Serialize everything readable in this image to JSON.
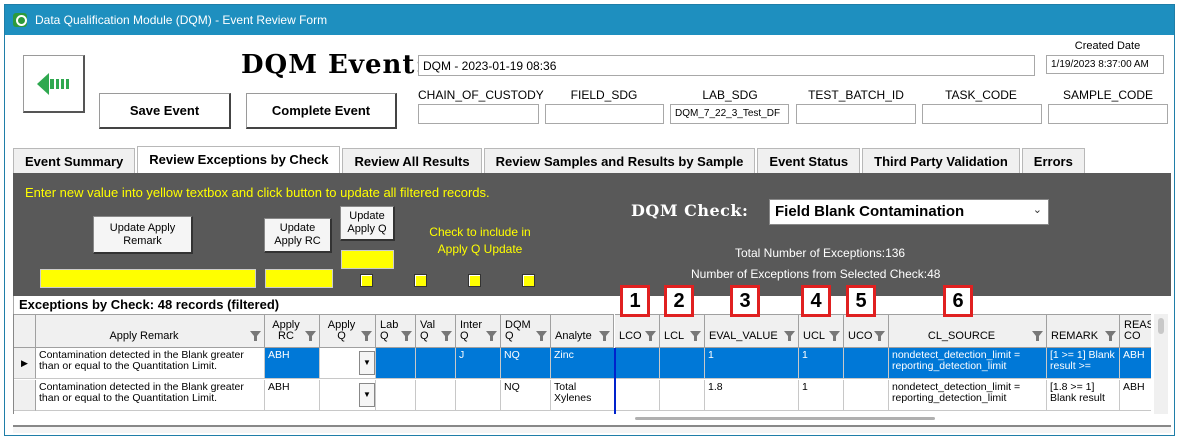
{
  "window": {
    "title": "Data Qualification Module (DQM) - Event Review Form"
  },
  "header": {
    "event_title": "DQM Event:",
    "event_name": "DQM - 2023-01-19 08:36",
    "created_date_label": "Created Date",
    "created_date": "1/19/2023 8:37:00 AM",
    "save_label": "Save Event",
    "complete_label": "Complete Event",
    "fields": [
      {
        "label": "CHAIN_OF_CUSTODY",
        "value": ""
      },
      {
        "label": "FIELD_SDG",
        "value": ""
      },
      {
        "label": "LAB_SDG",
        "value": "DQM_7_22_3_Test_DF"
      },
      {
        "label": "TEST_BATCH_ID",
        "value": ""
      },
      {
        "label": "TASK_CODE",
        "value": ""
      },
      {
        "label": "SAMPLE_CODE",
        "value": ""
      }
    ]
  },
  "tabs": [
    "Event Summary",
    "Review Exceptions by Check",
    "Review All Results",
    "Review Samples and Results by Sample",
    "Event Status",
    "Third Party Validation",
    "Errors"
  ],
  "panel": {
    "instruction": "Enter new value into yellow textbox and click button to update all filtered records.",
    "btn_apply_remark": "Update Apply Remark",
    "btn_apply_rc": "Update Apply RC",
    "btn_apply_q": "Update Apply Q",
    "include_note": "Check to include in Apply Q Update",
    "dqm_check_label": "DQM Check:",
    "dqm_check_value": "Field Blank Contamination",
    "total_exceptions": "Total Number of Exceptions:136",
    "selected_exceptions": "Number of Exceptions from Selected Check:48"
  },
  "grid": {
    "title": "Exceptions by Check: 48 records (filtered)",
    "callouts": [
      "1",
      "2",
      "3",
      "4",
      "5",
      "6"
    ],
    "columns": [
      "Apply Remark",
      "Apply RC",
      "Apply Q",
      "Lab Q",
      "Val Q",
      "Inter Q",
      "DQM Q",
      "Analyte",
      "LCO",
      "LCL",
      "EVAL_VALUE",
      "UCL",
      "UCO",
      "CL_SOURCE",
      "REMARK",
      "REAS CO"
    ],
    "rows": [
      {
        "apply_remark": "Contamination detected in the Blank greater than or equal to the Quantitation Limit.",
        "apply_rc": "ABH",
        "apply_q": "",
        "lab_q": "",
        "val_q": "",
        "inter_q": "J",
        "dqm_q": "NQ",
        "analyte": "Zinc",
        "lco": "",
        "lcl": "",
        "eval_value": "1",
        "ucl": "1",
        "uco": "",
        "cl_source": "nondetect_detection_limit = reporting_detection_limit",
        "remark": "[1 >= 1] Blank result >=",
        "reas": "ABH"
      },
      {
        "apply_remark": "Contamination detected in the Blank greater than or equal to the Quantitation Limit.",
        "apply_rc": "ABH",
        "apply_q": "",
        "lab_q": "",
        "val_q": "",
        "inter_q": "",
        "dqm_q": "NQ",
        "analyte": "Total Xylenes",
        "lco": "",
        "lcl": "",
        "eval_value": "1.8",
        "ucl": "1",
        "uco": "",
        "cl_source": "nondetect_detection_limit = reporting_detection_limit",
        "remark": "[1.8 >= 1] Blank result",
        "reas": "ABH"
      }
    ]
  }
}
